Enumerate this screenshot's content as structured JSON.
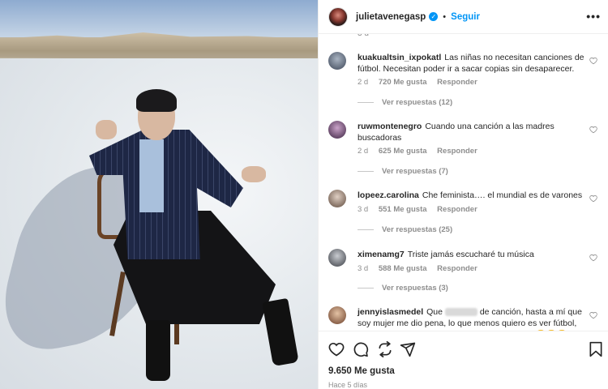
{
  "post": {
    "username": "julietavenegasp",
    "follow_label": "Seguir",
    "dot": "•",
    "verified_mark": "✓",
    "more_label": "•••"
  },
  "comments": {
    "stub": "3 d",
    "items": [
      {
        "username": "kuakualtsin_ixpokatl",
        "text": "Las niñas no necesitan canciones de fútbol. Necesitan poder ir a sacar copias sin desaparecer.",
        "age": "2 d",
        "likes": "720 Me gusta",
        "reply_label": "Responder",
        "view_replies": "Ver respuestas (12)"
      },
      {
        "username": "ruwmontenegro",
        "text": "Cuando una canción a las madres buscadoras",
        "age": "2 d",
        "likes": "625 Me gusta",
        "reply_label": "Responder",
        "view_replies": "Ver respuestas (7)"
      },
      {
        "username": "lopeez.carolina",
        "text": "Che feminista…. el mundial es de varones",
        "age": "3 d",
        "likes": "551 Me gusta",
        "reply_label": "Responder",
        "view_replies": "Ver respuestas (25)"
      },
      {
        "username": "ximenamg7",
        "text": "Triste jamás escucharé tu música",
        "age": "3 d",
        "likes": "588 Me gusta",
        "reply_label": "Responder",
        "view_replies": "Ver respuestas (3)"
      },
      {
        "username": "jennyislasmedel",
        "text_before": "Que",
        "text_after": "de canción, hasta a mí que soy mujer me dio pena, lo que menos quiero es ver fútbol, mucho menos poteco un balón como los vatos 😂😂😂"
      }
    ]
  },
  "footer": {
    "likes": "9.650 Me gusta",
    "ago": "Hace 5 días"
  },
  "colors": {
    "accent": "#0095f6",
    "text": "#262626",
    "muted": "#8e8e8e"
  },
  "icons": [
    "heart-icon",
    "comment-icon",
    "share-icon",
    "send-icon",
    "bookmark-icon"
  ]
}
